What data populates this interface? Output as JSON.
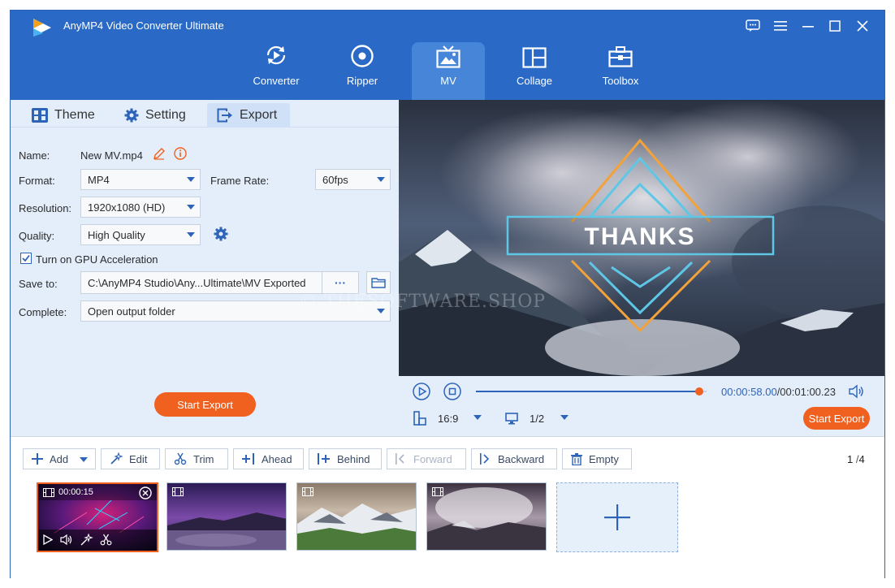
{
  "app": {
    "title": "AnyMP4 Video Converter Ultimate"
  },
  "nav": [
    {
      "label": "Converter",
      "icon": "converter-icon"
    },
    {
      "label": "Ripper",
      "icon": "ripper-icon"
    },
    {
      "label": "MV",
      "icon": "mv-icon",
      "active": true
    },
    {
      "label": "Collage",
      "icon": "collage-icon"
    },
    {
      "label": "Toolbox",
      "icon": "toolbox-icon"
    }
  ],
  "tabs": [
    {
      "label": "Theme",
      "icon": "theme-icon"
    },
    {
      "label": "Setting",
      "icon": "gear-icon"
    },
    {
      "label": "Export",
      "icon": "export-icon",
      "active": true
    }
  ],
  "export": {
    "name_label": "Name:",
    "name_value": "New MV.mp4",
    "format_label": "Format:",
    "format_value": "MP4",
    "frame_rate_label": "Frame Rate:",
    "frame_rate_value": "60fps",
    "resolution_label": "Resolution:",
    "resolution_value": "1920x1080 (HD)",
    "quality_label": "Quality:",
    "quality_value": "High Quality",
    "gpu_label": "Turn on GPU Acceleration",
    "gpu_checked": true,
    "save_to_label": "Save to:",
    "save_to_value": "C:\\AnyMP4 Studio\\Any...Ultimate\\MV Exported",
    "browse_label": "···",
    "complete_label": "Complete:",
    "complete_value": "Open output folder",
    "start_export": "Start Export"
  },
  "preview": {
    "overlay_text": "THANKS",
    "watermark": "© THESOFTWARE.SHOP"
  },
  "player": {
    "time_current": "00:00:58.00",
    "time_total": "/00:01:00.23",
    "progress": 0.97,
    "aspect": "16:9",
    "screen": "1/2",
    "start_export": "Start Export"
  },
  "toolbar": {
    "add": "Add",
    "edit": "Edit",
    "trim": "Trim",
    "ahead": "Ahead",
    "behind": "Behind",
    "forward": "Forward",
    "backward": "Backward",
    "empty": "Empty",
    "page_current": "1",
    "page_sep": "/",
    "page_total": "4"
  },
  "clips": [
    {
      "duration": "00:00:15",
      "active": true
    },
    {
      "duration": ""
    },
    {
      "duration": ""
    },
    {
      "duration": ""
    }
  ],
  "colors": {
    "accent": "#2a6ac6",
    "orange": "#f0601f",
    "panel": "#e4eefb"
  }
}
